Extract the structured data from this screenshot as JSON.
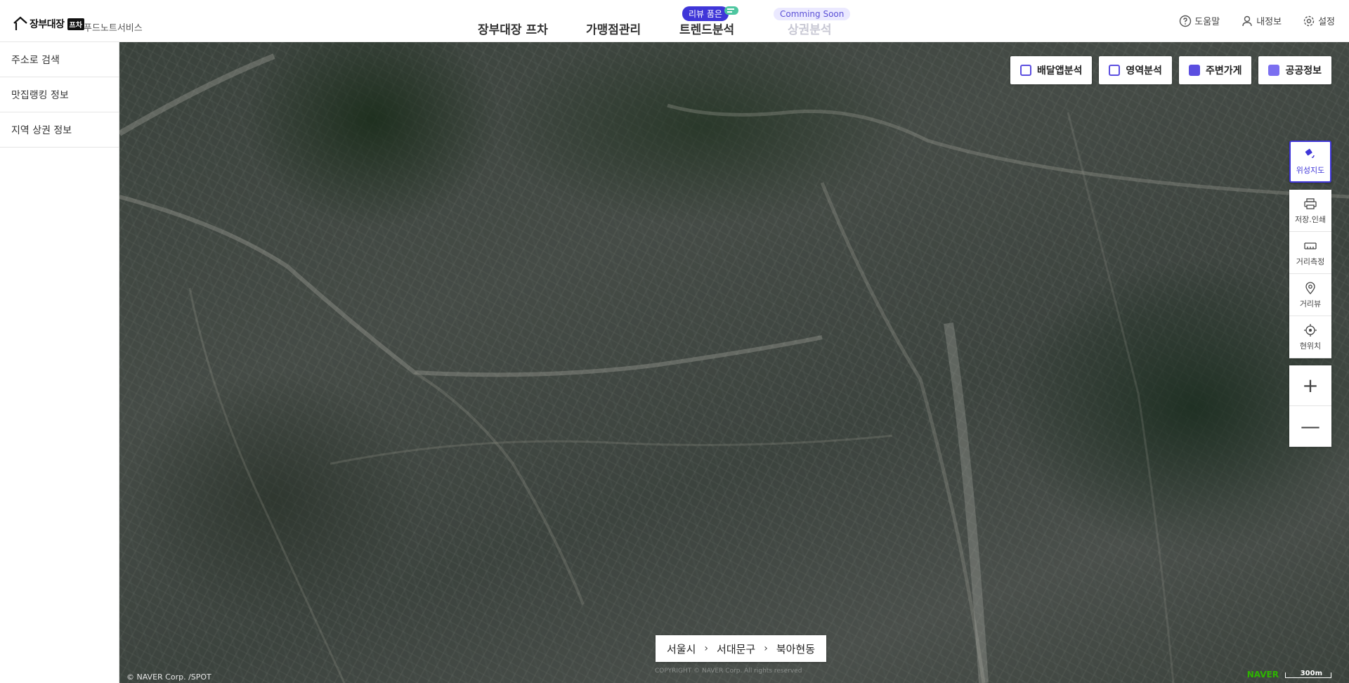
{
  "header": {
    "logo_text": "장부대장",
    "logo_badge": "프차",
    "service_name": "푸드노트서비스",
    "nav": [
      {
        "label": "장부대장 프차"
      },
      {
        "label": "가맹점관리"
      },
      {
        "label": "트렌드분석",
        "badge": "리뷰 품은"
      },
      {
        "label": "상권분석",
        "badge": "Comming Soon"
      }
    ],
    "right": [
      {
        "label": "도움말",
        "icon": "help-circle-icon"
      },
      {
        "label": "내정보",
        "icon": "user-icon"
      },
      {
        "label": "설정",
        "icon": "gear-icon"
      }
    ]
  },
  "sidebar": {
    "items": [
      {
        "label": "주소로 검색"
      },
      {
        "label": "맛집랭킹 정보"
      },
      {
        "label": "지역 상권 정보"
      }
    ]
  },
  "map": {
    "top_tools": [
      {
        "label": "배달앱분석",
        "icon": "delivery-analysis-icon",
        "color": "#5b4ee0"
      },
      {
        "label": "영역분석",
        "icon": "area-analysis-icon",
        "color": "#5b4ee0"
      },
      {
        "label": "주변가게",
        "icon": "store-icon",
        "color": "#5b4ee0"
      },
      {
        "label": "공공정보",
        "icon": "public-info-icon",
        "color": "#7b6ff0"
      }
    ],
    "side_tools": [
      {
        "label": "위성지도",
        "icon": "satellite-icon"
      },
      {
        "label": "저장.인쇄",
        "icon": "print-icon"
      },
      {
        "label": "거리측정",
        "icon": "ruler-icon"
      },
      {
        "label": "거리뷰",
        "icon": "location-pin-icon"
      },
      {
        "label": "현위치",
        "icon": "crosshair-icon"
      }
    ],
    "zoom_in": "+",
    "zoom_out": "—",
    "breadcrumb": [
      "서울시",
      "서대문구",
      "북아현동"
    ],
    "copyright_left": "© NAVER Corp. /SPOT",
    "copyright_center": "COPYRIGHT © NAVER Corp. All rights reserved",
    "naver": "NAVER",
    "scale": "300m"
  },
  "colors": {
    "accent": "#3f36d8",
    "badge_soon_bg": "#ebe9ff"
  }
}
